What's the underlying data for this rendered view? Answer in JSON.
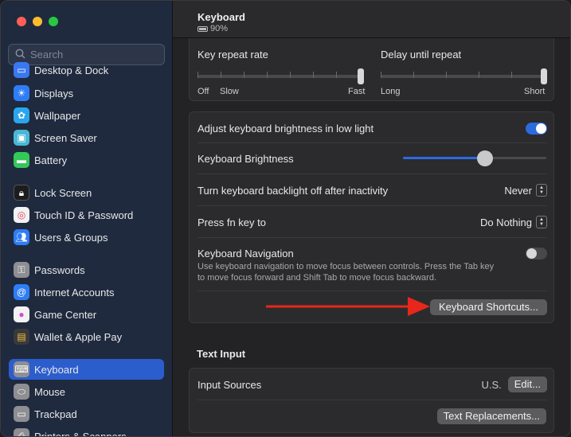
{
  "sidebar": {
    "search_placeholder": "Search",
    "items": [
      {
        "label": "Desktop & Dock",
        "icon": "dock-icon",
        "color": "#3a78f2"
      },
      {
        "label": "Displays",
        "icon": "displays-icon",
        "color": "#2f7df6"
      },
      {
        "label": "Wallpaper",
        "icon": "wallpaper-icon",
        "color": "#2aa6ee"
      },
      {
        "label": "Screen Saver",
        "icon": "screen-saver-icon",
        "color": "#49b8d6"
      },
      {
        "label": "Battery",
        "icon": "battery-icon",
        "color": "#34c759"
      },
      {
        "label": "Lock Screen",
        "icon": "lock-icon",
        "color": "#1c1c1e"
      },
      {
        "label": "Touch ID & Password",
        "icon": "fingerprint-icon",
        "color": "#f2f2f2"
      },
      {
        "label": "Users & Groups",
        "icon": "users-icon",
        "color": "#2f7df6"
      },
      {
        "label": "Passwords",
        "icon": "key-icon",
        "color": "#8e8e93"
      },
      {
        "label": "Internet Accounts",
        "icon": "at-icon",
        "color": "#2f7df6"
      },
      {
        "label": "Game Center",
        "icon": "game-center-icon",
        "color": "#f2f2f2"
      },
      {
        "label": "Wallet & Apple Pay",
        "icon": "wallet-icon",
        "color": "#3a3a3c"
      },
      {
        "label": "Keyboard",
        "icon": "keyboard-icon",
        "color": "#8e8e93"
      },
      {
        "label": "Mouse",
        "icon": "mouse-icon",
        "color": "#8e8e93"
      },
      {
        "label": "Trackpad",
        "icon": "trackpad-icon",
        "color": "#8e8e93"
      },
      {
        "label": "Printers & Scanners",
        "icon": "printer-icon",
        "color": "#8e8e93"
      }
    ]
  },
  "header": {
    "title": "Keyboard",
    "battery": "90%"
  },
  "repeat": {
    "key_repeat_label": "Key repeat rate",
    "delay_label": "Delay until repeat",
    "off": "Off",
    "slow": "Slow",
    "fast": "Fast",
    "long": "Long",
    "short": "Short"
  },
  "brightness": {
    "adjust_label": "Adjust keyboard brightness in low light",
    "adjust_on": true,
    "brightness_label": "Keyboard Brightness",
    "brightness_level": 0.57,
    "backlight_label": "Turn keyboard backlight off after inactivity",
    "backlight_value": "Never",
    "fn_label": "Press fn key to",
    "fn_value": "Do Nothing",
    "nav_label": "Keyboard Navigation",
    "nav_desc_1": "Use keyboard navigation to move focus between controls. Press the Tab key",
    "nav_desc_2": "to move focus forward and Shift Tab to move focus backward.",
    "nav_on": false,
    "shortcuts_button": "Keyboard Shortcuts..."
  },
  "text_input": {
    "section_title": "Text Input",
    "input_sources_label": "Input Sources",
    "input_sources_value": "U.S.",
    "edit_button": "Edit...",
    "replacements_button": "Text Replacements..."
  },
  "colors": {
    "accent": "#2c6ae0",
    "arrow": "#e8261c",
    "sidebar_selected": "#2c5dcd"
  }
}
